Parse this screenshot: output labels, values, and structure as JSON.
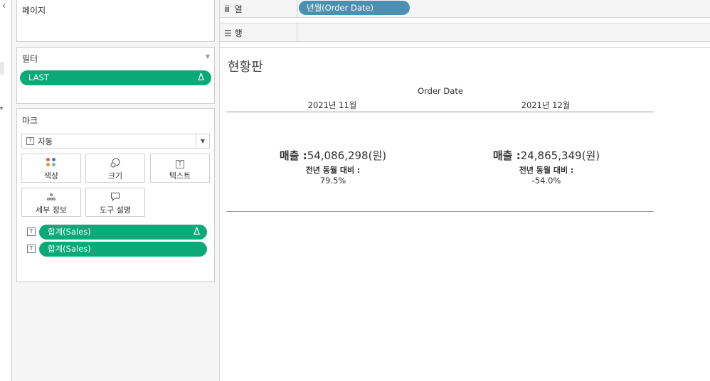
{
  "panels": {
    "pages_title": "페이지",
    "filters_title": "필터",
    "marks_title": "마크"
  },
  "filters": {
    "pill_label": "LAST",
    "pill_delta": "Δ"
  },
  "marks": {
    "type_select": "자동",
    "buttons": {
      "color": "색상",
      "size": "크기",
      "text": "텍스트",
      "detail": "세부 정보",
      "tooltip": "도구 설명"
    },
    "fields": [
      {
        "label": "합계(Sales)",
        "delta": "Δ"
      },
      {
        "label": "합계(Sales)",
        "delta": ""
      }
    ]
  },
  "shelves": {
    "columns_label": "열",
    "columns_pill": "년월(Order Date)",
    "rows_label": "행"
  },
  "view": {
    "title": "현황판",
    "header": "Order Date",
    "columns": [
      {
        "month": "2021년 11월",
        "sales_prefix": "매출 :",
        "sales_value": "54,086,298",
        "sales_suffix": "(원)",
        "compare_label": "전년 동월 대비 :",
        "compare_value": "79.5%"
      },
      {
        "month": "2021년 12월",
        "sales_prefix": "매출 :",
        "sales_value": "24,865,349",
        "sales_suffix": "(원)",
        "compare_label": "전년 동월 대비 :",
        "compare_value": "-54.0%"
      }
    ]
  },
  "icons": {
    "columns_shelf": "column-bars-icon",
    "rows_shelf": "row-lines-icon",
    "color_palette": [
      "#e15759",
      "#4e79a7",
      "#f28e2b",
      "#76b7b2"
    ]
  }
}
